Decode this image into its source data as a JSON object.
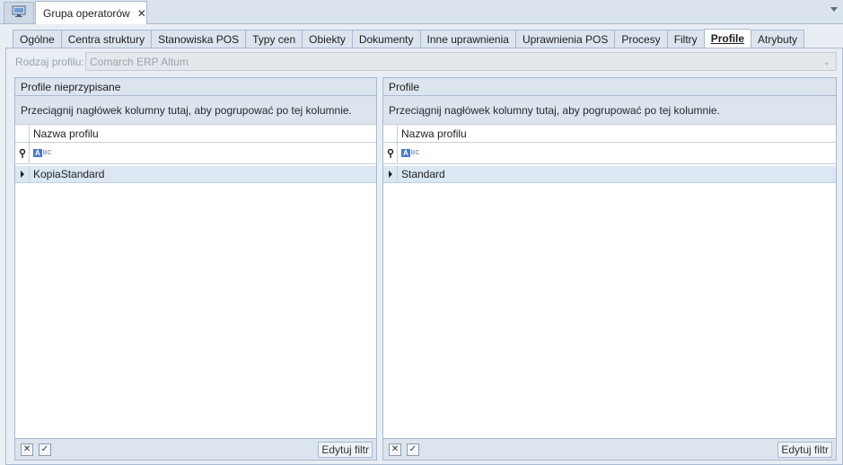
{
  "doc_tab": {
    "title": "Grupa operatorów",
    "close_glyph": "✕"
  },
  "tabs": [
    {
      "label": "Ogólne",
      "active": false
    },
    {
      "label": "Centra struktury",
      "active": false
    },
    {
      "label": "Stanowiska POS",
      "active": false
    },
    {
      "label": "Typy cen",
      "active": false
    },
    {
      "label": "Obiekty",
      "active": false
    },
    {
      "label": "Dokumenty",
      "active": false
    },
    {
      "label": "Inne uprawnienia",
      "active": false
    },
    {
      "label": "Uprawnienia POS",
      "active": false
    },
    {
      "label": "Procesy",
      "active": false
    },
    {
      "label": "Filtry",
      "active": false
    },
    {
      "label": "Profile",
      "active": true
    },
    {
      "label": "Atrybuty",
      "active": false
    }
  ],
  "rodzaj": {
    "label": "Rodzaj profilu:",
    "value": "Comarch ERP Altum"
  },
  "left_group": {
    "header": "Profile nieprzypisane",
    "group_panel": "Przeciągnij nagłówek kolumny tutaj, aby pogrupować po tej kolumnie.",
    "column": "Nazwa profilu",
    "filter_badge_a": "A",
    "filter_badge_bc": "BC",
    "rows": [
      "KopiaStandard"
    ],
    "edit_filter": "Edytuj filtr"
  },
  "right_group": {
    "header": "Profile",
    "group_panel": "Przeciągnij nagłówek kolumny tutaj, aby pogrupować po tej kolumnie.",
    "column": "Nazwa profilu",
    "filter_badge_a": "A",
    "filter_badge_bc": "BC",
    "rows": [
      "Standard"
    ],
    "edit_filter": "Edytuj filtr"
  },
  "footer": {
    "clear_glyph": "✕",
    "check_glyph": "✓"
  },
  "colors": {
    "background": "#e9eef5",
    "header_bg": "#dce4ee",
    "selected_row": "#dce7f4",
    "border": "#a9b9cf",
    "accent_badge": "#4a7ac4"
  },
  "icons": {
    "doc_icon": "monitor-icon",
    "filter_row_icon": "pin-icon",
    "row_indicator": "row-arrow-icon",
    "strip_menu": "chevron-down-icon"
  }
}
